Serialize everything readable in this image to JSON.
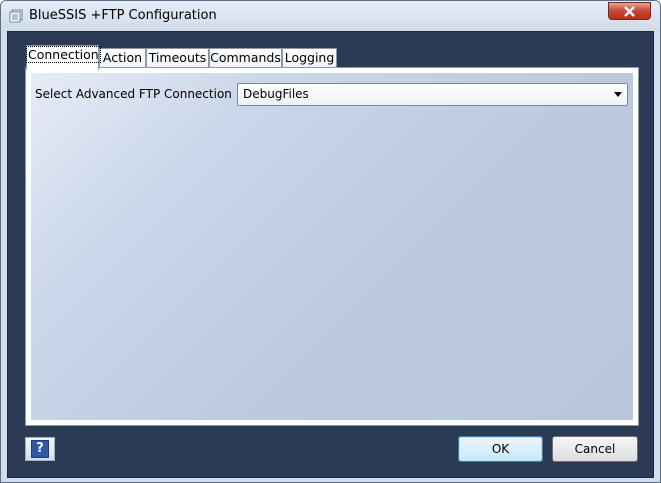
{
  "window": {
    "title": "BlueSSIS +FTP Configuration"
  },
  "tabs": [
    {
      "label": "Connection",
      "active": true
    },
    {
      "label": "Action",
      "active": false
    },
    {
      "label": "Timeouts",
      "active": false
    },
    {
      "label": "Commands",
      "active": false
    },
    {
      "label": "Logging",
      "active": false
    }
  ],
  "connection": {
    "label": "Select Advanced FTP Connection :",
    "selected": "DebugFiles"
  },
  "buttons": {
    "help": "?",
    "ok": "OK",
    "cancel": "Cancel"
  },
  "colors": {
    "frame": "#2b3a55",
    "panel_gradient_start": "#e6ecf7",
    "panel_gradient_end": "#b9c6dc",
    "close_button": "#c7472f"
  }
}
